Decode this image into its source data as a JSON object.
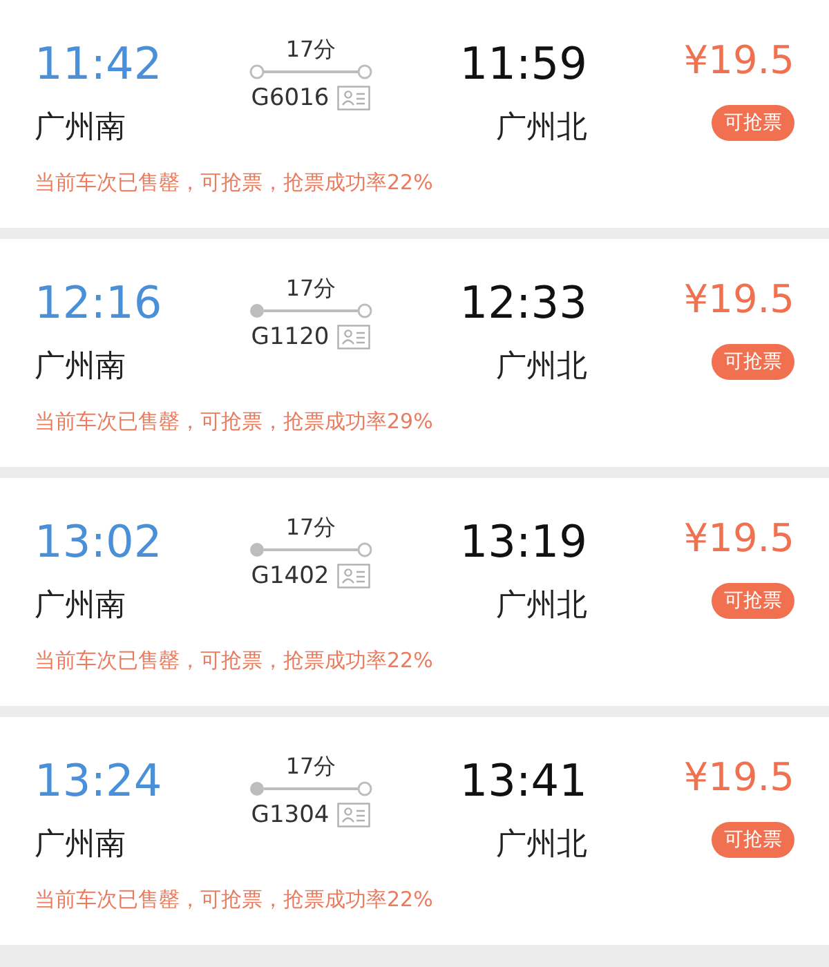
{
  "trains": [
    {
      "depart_time": "11:42",
      "depart_station": "广州南",
      "duration": "17分",
      "train_no": "G6016",
      "depart_circle_filled": false,
      "arrive_time": "11:59",
      "arrive_station": "广州北",
      "price": "¥19.5",
      "badge": "可抢票",
      "note": "当前车次已售罄，可抢票，抢票成功率22%"
    },
    {
      "depart_time": "12:16",
      "depart_station": "广州南",
      "duration": "17分",
      "train_no": "G1120",
      "depart_circle_filled": true,
      "arrive_time": "12:33",
      "arrive_station": "广州北",
      "price": "¥19.5",
      "badge": "可抢票",
      "note": "当前车次已售罄，可抢票，抢票成功率29%"
    },
    {
      "depart_time": "13:02",
      "depart_station": "广州南",
      "duration": "17分",
      "train_no": "G1402",
      "depart_circle_filled": true,
      "arrive_time": "13:19",
      "arrive_station": "广州北",
      "price": "¥19.5",
      "badge": "可抢票",
      "note": "当前车次已售罄，可抢票，抢票成功率22%"
    },
    {
      "depart_time": "13:24",
      "depart_station": "广州南",
      "duration": "17分",
      "train_no": "G1304",
      "depart_circle_filled": true,
      "arrive_time": "13:41",
      "arrive_station": "广州北",
      "price": "¥19.5",
      "badge": "可抢票",
      "note": "当前车次已售罄，可抢票，抢票成功率22%"
    }
  ]
}
